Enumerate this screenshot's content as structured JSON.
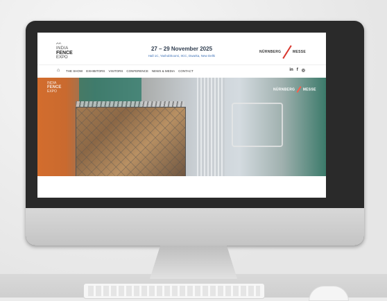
{
  "site": {
    "logo": {
      "line1": "INDIA",
      "line2": "FENCE",
      "line3": "EXPO",
      "mark": "ᨓ"
    },
    "event": {
      "dates": "27 – 29 November 2025",
      "venue": "Hall 1C, Yashobhoomi, IICC, Dwarka, New Delhi"
    },
    "partner": {
      "left": "NÜRNBERG",
      "right": "MESSE"
    },
    "nav": {
      "home_icon": "home-icon",
      "items": [
        "THE SHOW",
        "EXHIBITORS",
        "VISITORS",
        "CONFERENCE",
        "NEWS & MEDIA",
        "CONTACT"
      ],
      "social": [
        "in",
        "f",
        "◎"
      ]
    },
    "hero": {
      "logo": {
        "line1": "INDIA",
        "line2": "FENCE",
        "line3": "EXPO"
      },
      "partner": {
        "left": "NÜRNBERG",
        "right": "MESSE"
      }
    }
  }
}
